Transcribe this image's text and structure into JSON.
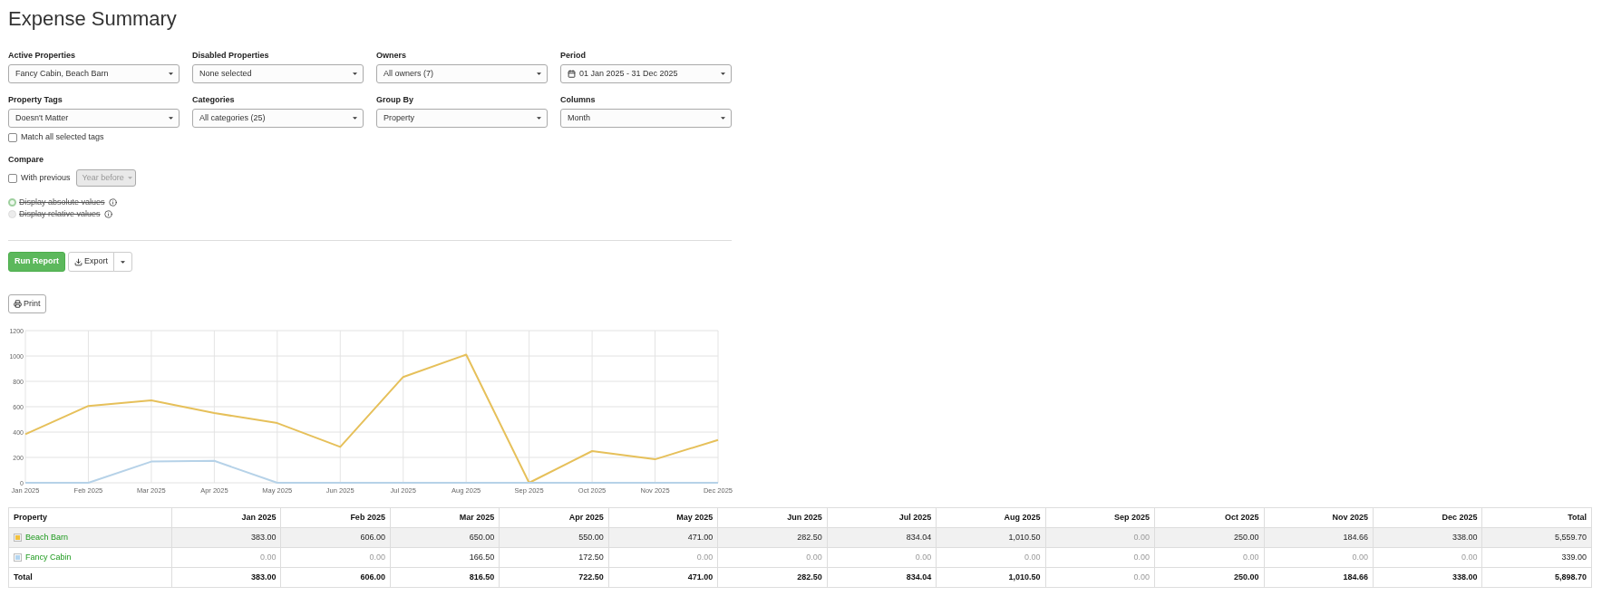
{
  "page": {
    "title": "Expense Summary"
  },
  "filters": [
    {
      "label": "Active Properties",
      "value": "Fancy Cabin, Beach Barn",
      "kind": "select"
    },
    {
      "label": "Disabled Properties",
      "value": "None selected",
      "kind": "select"
    },
    {
      "label": "Owners",
      "value": "All owners (7)",
      "kind": "select"
    },
    {
      "label": "Period",
      "value": "01 Jan 2025 - 31 Dec 2025",
      "kind": "date"
    },
    {
      "label": "Property Tags",
      "value": "Doesn't Matter",
      "kind": "select",
      "option": {
        "label": "Match all selected tags",
        "checked": false
      }
    },
    {
      "label": "Categories",
      "value": "All categories (25)",
      "kind": "select"
    },
    {
      "label": "Group By",
      "value": "Property",
      "kind": "select"
    },
    {
      "label": "Columns",
      "value": "Month",
      "kind": "select"
    }
  ],
  "compare": {
    "label": "Compare",
    "with_previous": {
      "label": "With previous",
      "checked": false
    },
    "offset": {
      "value": "Year before",
      "disabled": true
    }
  },
  "display_mode": [
    {
      "label": "Display absolute values",
      "selected": true,
      "disabled": true
    },
    {
      "label": "Display relative values",
      "selected": false,
      "disabled": true
    }
  ],
  "actions": {
    "run": "Run Report",
    "export": "Export",
    "print": "Print"
  },
  "chart": {
    "chart_data": {
      "type": "line",
      "grid": true,
      "categories": [
        "Jan 2025",
        "Feb 2025",
        "Mar 2025",
        "Apr 2025",
        "May 2025",
        "Jun 2025",
        "Jul 2025",
        "Aug 2025",
        "Sep 2025",
        "Oct 2025",
        "Nov 2025",
        "Dec 2025"
      ],
      "series": [
        {
          "color": "#e6c05a",
          "values": [
            383,
            606,
            650,
            550,
            471,
            283,
            834,
            1011,
            0,
            250,
            185,
            338
          ]
        },
        {
          "color": "#b6d2e8",
          "values": [
            0,
            0,
            167,
            173,
            0,
            0,
            0,
            0,
            0,
            0,
            0,
            0
          ]
        }
      ],
      "ylim": [
        0,
        1200
      ],
      "yticks": [
        0,
        200,
        400,
        600,
        800,
        1000,
        1200
      ]
    }
  },
  "table": {
    "columns": [
      "Property",
      "Jan 2025",
      "Feb 2025",
      "Mar 2025",
      "Apr 2025",
      "May 2025",
      "Jun 2025",
      "Jul 2025",
      "Aug 2025",
      "Sep 2025",
      "Oct 2025",
      "Nov 2025",
      "Dec 2025",
      "Total"
    ],
    "rows": [
      {
        "kind": "property",
        "color": "#f2c13e",
        "cells": [
          {
            "text": "Beach Barn",
            "muted": false
          },
          {
            "text": "383.00",
            "muted": false
          },
          {
            "text": "606.00",
            "muted": false
          },
          {
            "text": "650.00",
            "muted": false
          },
          {
            "text": "550.00",
            "muted": false
          },
          {
            "text": "471.00",
            "muted": false
          },
          {
            "text": "282.50",
            "muted": false
          },
          {
            "text": "834.04",
            "muted": false
          },
          {
            "text": "1,010.50",
            "muted": false
          },
          {
            "text": "0.00",
            "muted": true
          },
          {
            "text": "250.00",
            "muted": false
          },
          {
            "text": "184.66",
            "muted": false
          },
          {
            "text": "338.00",
            "muted": false
          },
          {
            "text": "5,559.70",
            "muted": false
          }
        ]
      },
      {
        "kind": "property",
        "color": "#b3d5f0",
        "cells": [
          {
            "text": "Fancy Cabin",
            "muted": false
          },
          {
            "text": "0.00",
            "muted": true
          },
          {
            "text": "0.00",
            "muted": true
          },
          {
            "text": "166.50",
            "muted": false
          },
          {
            "text": "172.50",
            "muted": false
          },
          {
            "text": "0.00",
            "muted": true
          },
          {
            "text": "0.00",
            "muted": true
          },
          {
            "text": "0.00",
            "muted": true
          },
          {
            "text": "0.00",
            "muted": true
          },
          {
            "text": "0.00",
            "muted": true
          },
          {
            "text": "0.00",
            "muted": true
          },
          {
            "text": "0.00",
            "muted": true
          },
          {
            "text": "0.00",
            "muted": true
          },
          {
            "text": "339.00",
            "muted": false
          }
        ]
      },
      {
        "kind": "total",
        "cells": [
          {
            "text": "Total",
            "muted": false
          },
          {
            "text": "383.00",
            "muted": false
          },
          {
            "text": "606.00",
            "muted": false
          },
          {
            "text": "816.50",
            "muted": false
          },
          {
            "text": "722.50",
            "muted": false
          },
          {
            "text": "471.00",
            "muted": false
          },
          {
            "text": "282.50",
            "muted": false
          },
          {
            "text": "834.04",
            "muted": false
          },
          {
            "text": "1,010.50",
            "muted": false
          },
          {
            "text": "0.00",
            "muted": true
          },
          {
            "text": "250.00",
            "muted": false
          },
          {
            "text": "184.66",
            "muted": false
          },
          {
            "text": "338.00",
            "muted": false
          },
          {
            "text": "5,898.70",
            "muted": false
          }
        ]
      }
    ]
  }
}
